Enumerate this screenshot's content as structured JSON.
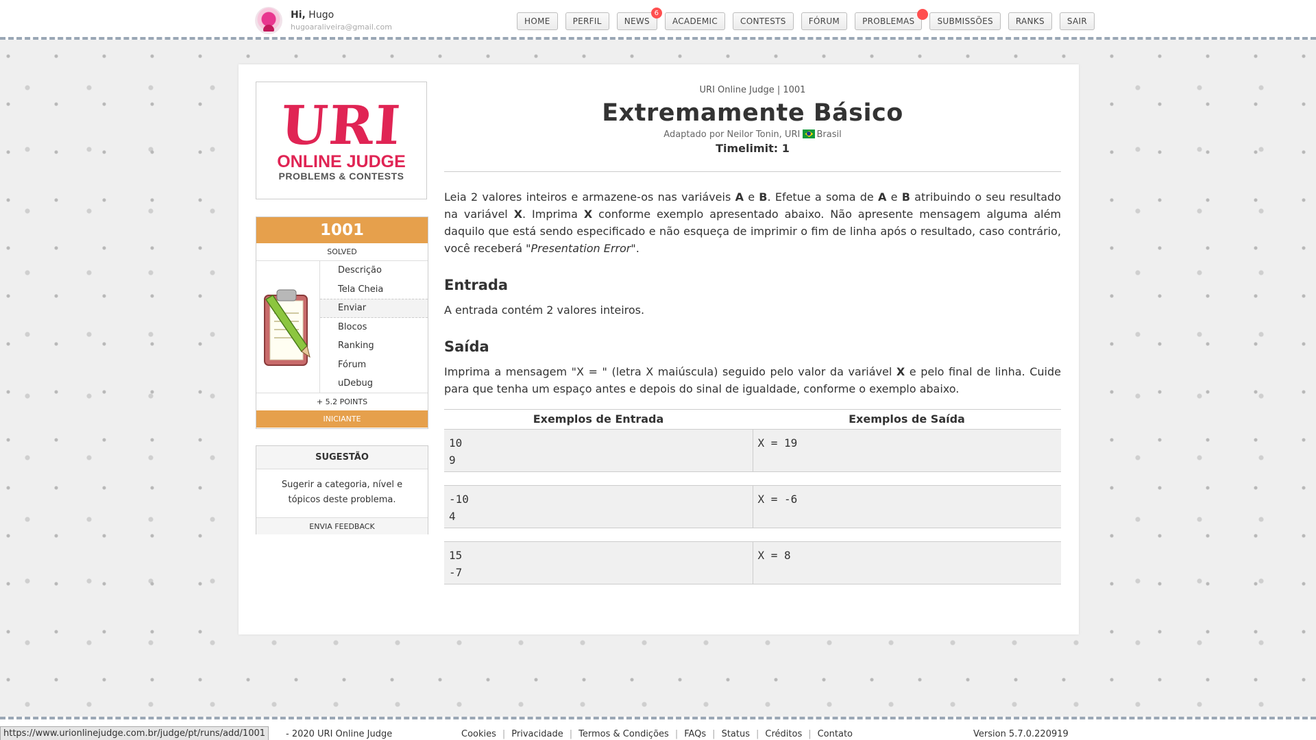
{
  "user": {
    "greeting": "Hi,",
    "name": "Hugo",
    "email": "hugoaraliveira@gmail.com"
  },
  "nav": {
    "items": [
      {
        "label": "HOME"
      },
      {
        "label": "PERFIL"
      },
      {
        "label": "NEWS",
        "badge": "6"
      },
      {
        "label": "ACADEMIC"
      },
      {
        "label": "CONTESTS"
      },
      {
        "label": "FÓRUM"
      },
      {
        "label": "PROBLEMAS",
        "dot": true
      },
      {
        "label": "SUBMISSÕES"
      },
      {
        "label": "RANKS"
      },
      {
        "label": "SAIR"
      }
    ]
  },
  "logo": {
    "line1": "URI",
    "line2": "ONLINE JUDGE",
    "line3": "PROBLEMS & CONTESTS"
  },
  "problem_box": {
    "number": "1001",
    "status": "SOLVED",
    "menu": [
      "Descrição",
      "Tela Cheia",
      "Enviar",
      "Blocos",
      "Ranking",
      "Fórum",
      "uDebug"
    ],
    "points": "+ 5.2 POINTS",
    "level": "INICIANTE"
  },
  "suggestion": {
    "title": "SUGESTÃO",
    "text": "Sugerir a categoria, nível e tópicos deste problema.",
    "button": "ENVIA FEEDBACK"
  },
  "problem": {
    "breadcrumb": "URI Online Judge | 1001",
    "title": "Extremamente Básico",
    "author_prefix": "Adaptado por Neilor Tonin, URI",
    "country": "Brasil",
    "timelimit": "Timelimit: 1",
    "description": {
      "t1": "Leia 2 valores inteiros e armazene-os nas variáveis ",
      "b1": "A",
      "t2": " e ",
      "b2": "B",
      "t3": ". Efetue a soma de ",
      "b3": "A",
      "t4": " e ",
      "b4": "B",
      "t5": " atribuindo o seu resultado na variável ",
      "b5": "X",
      "t6": ". Imprima ",
      "b6": "X",
      "t7": " conforme exemplo apresentado abaixo. Não apresente mensagem alguma além daquilo que está sendo especificado e não esqueça de imprimir o fim de linha após o resultado, caso contrário, você receberá \"",
      "i1": "Presentation Error",
      "t8": "\"."
    },
    "input_title": "Entrada",
    "input_text": "A entrada contém 2 valores inteiros.",
    "output_title": "Saída",
    "output": {
      "t1": "Imprima a mensagem \"X = \" (letra X maiúscula) seguido pelo valor da variável ",
      "b1": "X",
      "t2": " e pelo final de linha. Cuide para que tenha um espaço antes e depois do sinal de igualdade, conforme o exemplo abaixo."
    },
    "examples_header": {
      "input": "Exemplos de Entrada",
      "output": "Exemplos de Saída"
    },
    "examples": [
      {
        "input": "10\n9",
        "output": "X = 19"
      },
      {
        "input": "-10\n4",
        "output": "X = -6"
      },
      {
        "input": "15\n-7",
        "output": "X = 8"
      }
    ]
  },
  "footer": {
    "status_url": "https://www.urionlinejudge.com.br/judge/pt/runs/add/1001",
    "copyright": "- 2020 URI Online Judge",
    "links": [
      "Cookies",
      "Privacidade",
      "Termos & Condições",
      "FAQs",
      "Status",
      "Créditos",
      "Contato"
    ],
    "version": "Version 5.7.0.220919"
  },
  "colors": {
    "accent": "#e6a04c",
    "brand": "#e02454",
    "badge": "#ff4f4f"
  }
}
